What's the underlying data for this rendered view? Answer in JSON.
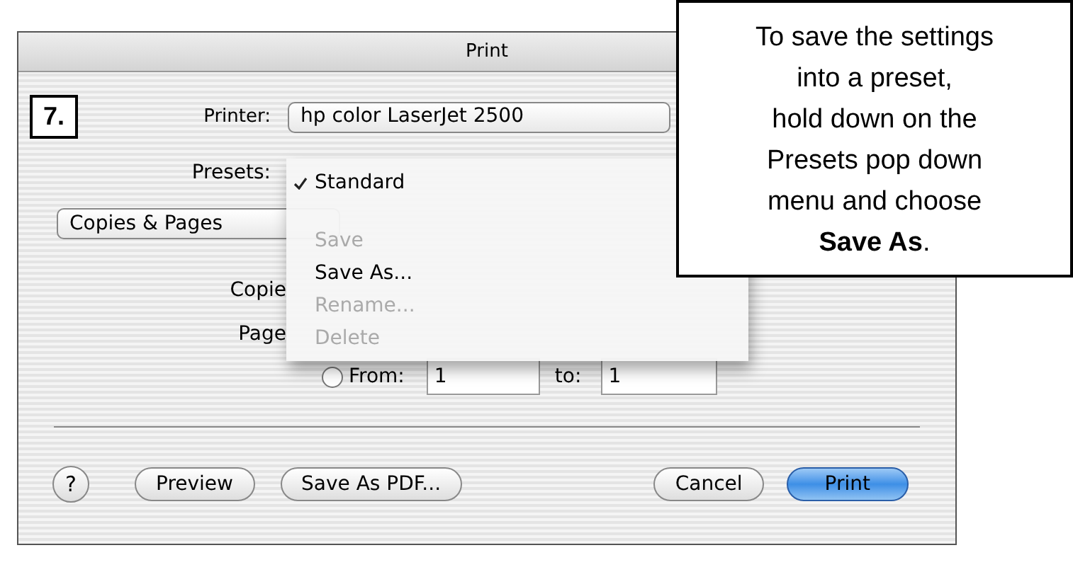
{
  "window": {
    "title": "Print"
  },
  "step_label": "7.",
  "printer": {
    "label": "Printer:",
    "value": "hp color LaserJet 2500"
  },
  "presets": {
    "label": "Presets:"
  },
  "presets_menu": [
    {
      "label": "Standard",
      "checked": true,
      "disabled": false
    },
    {
      "label": "Save",
      "checked": false,
      "disabled": true
    },
    {
      "label": "Save As...",
      "checked": false,
      "disabled": false
    },
    {
      "label": "Rename...",
      "checked": false,
      "disabled": true
    },
    {
      "label": "Delete",
      "checked": false,
      "disabled": true
    }
  ],
  "pane_popup": {
    "value": "Copies & Pages"
  },
  "copies": {
    "label": "Copie"
  },
  "pages": {
    "label": "Page",
    "from_label": "From:",
    "from_value": "1",
    "to_label": "to:",
    "to_value": "1",
    "from_selected": false
  },
  "buttons": [
    {
      "label": "?",
      "kind": "help"
    },
    {
      "label": "Preview",
      "kind": "normal"
    },
    {
      "label": "Save As PDF...",
      "kind": "normal"
    },
    {
      "label": "Cancel",
      "kind": "normal"
    },
    {
      "label": "Print",
      "kind": "default"
    }
  ],
  "callout": "To save the settings\ninto a preset,\nhold down on the\nPresets pop down\nmenu and choose\n**Save As**."
}
